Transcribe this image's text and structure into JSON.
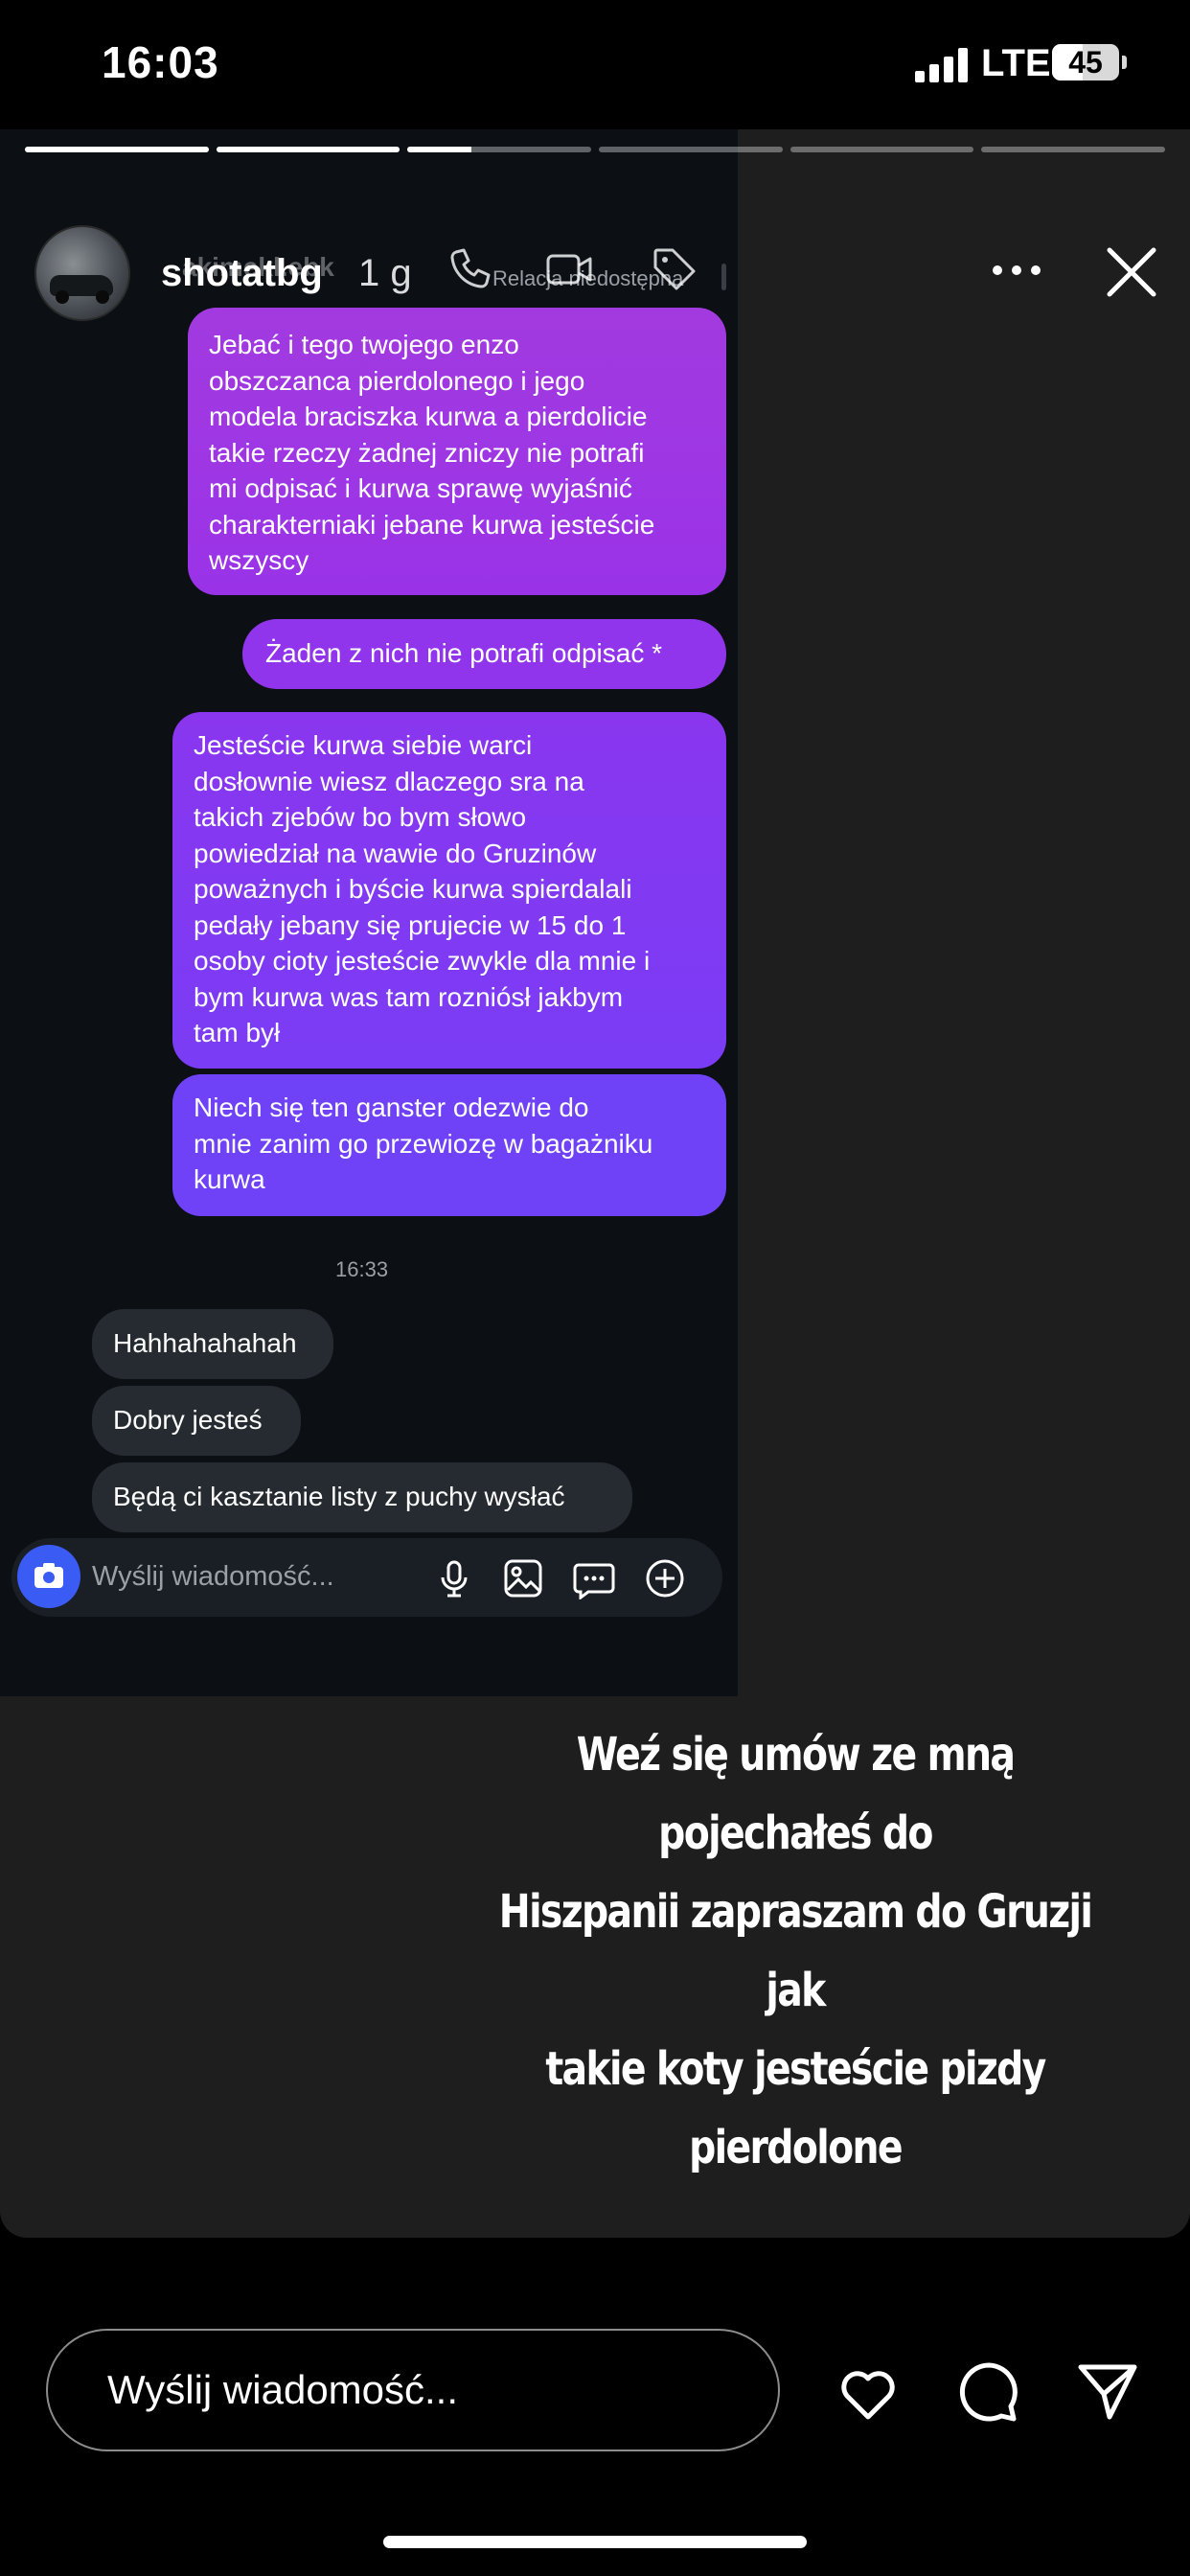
{
  "status_bar": {
    "time": "16:03",
    "network": "LTE",
    "battery": "45"
  },
  "story": {
    "username": "shotatbg",
    "overlapped_name": "akimekl.ebk",
    "time_ago": "1 g",
    "progress": [
      1,
      1,
      0.35,
      0,
      0,
      0
    ],
    "caption": "Weź się umów ze mną pojechałeś do\nHiszpanii zapraszam do Gruzji jak\ntakie koty jesteście pizdy\npierdolone"
  },
  "chat": {
    "status_note": "Relacja niedostępna",
    "sent_messages": [
      "Jebać i tego twojego enzo\nobszczanca pierdolonego i jego\nmodela braciszka kurwa a pierdolicie\ntakie rzeczy żadnej zniczy nie potrafi\nmi odpisać i kurwa sprawę wyjaśnić\ncharakterniaki jebane kurwa jesteście\nwszyscy",
      "Żaden z nich nie potrafi odpisać *",
      "Jesteście kurwa siebie warci\ndosłownie wiesz dlaczego sra na\ntakich zjebów bo bym słowo\npowiedział na wawie do Gruzinów\npoważnych i byście kurwa spierdalali\npedały jebany się prujecie w 15 do 1\nosoby cioty jesteście zwykle dla mnie i\nbym kurwa was tam rozniósł jakbym\ntam był",
      "Niech się ten ganster odezwie do\nmnie zanim go przewiozę w bagażniku\nkurwa"
    ],
    "timestamp": "16:33",
    "received_messages": [
      "Hahhahahahah",
      "Dobry jesteś",
      "Będą ci kasztanie listy z puchy wysłać"
    ],
    "input_placeholder": "Wyślij wiadomość..."
  },
  "reply": {
    "placeholder": "Wyślij wiadomość..."
  }
}
